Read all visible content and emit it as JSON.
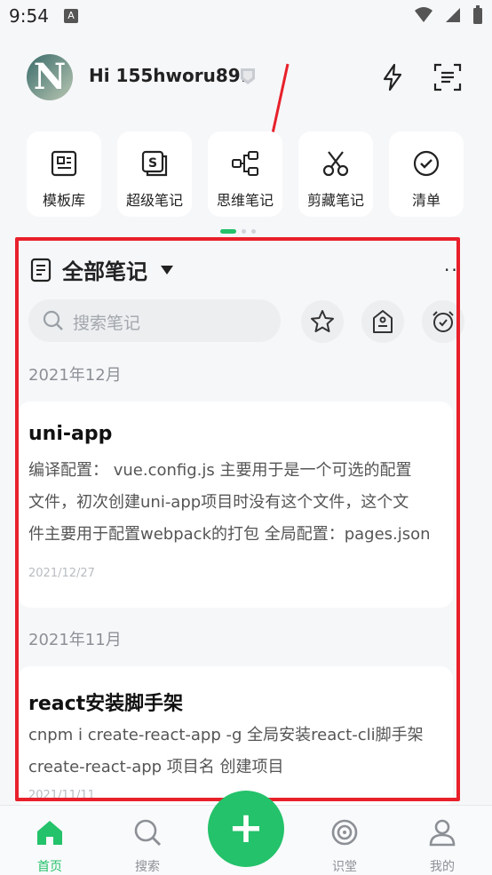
{
  "status_bar": {
    "time": "9:54",
    "notif_letter": "A"
  },
  "header": {
    "avatar_letter": "N",
    "greeting": "Hi 155hworu891"
  },
  "quick_actions": [
    {
      "label": "模板库",
      "icon": "template-library-icon"
    },
    {
      "label": "超级笔记",
      "icon": "super-note-icon"
    },
    {
      "label": "思维笔记",
      "icon": "mind-map-icon"
    },
    {
      "label": "剪藏笔记",
      "icon": "scissors-icon"
    },
    {
      "label": "清单",
      "icon": "checklist-icon"
    }
  ],
  "notes_section": {
    "title": "全部笔记",
    "more": "··",
    "search_placeholder": "搜索笔记",
    "groups": [
      {
        "month": "2021年12月",
        "notes": [
          {
            "title": "uni-app",
            "lines": [
              "编译配置： vue.config.js 主要用于是一个可选的配置",
              "文件，初次创建uni-app项目时没有这个文件，这个文",
              "件主要用于配置webpack的打包 全局配置：pages.json"
            ],
            "date": "2021/12/27"
          }
        ]
      },
      {
        "month": "2021年11月",
        "notes": [
          {
            "title": "react安装脚手架",
            "lines": [
              "cnpm i create-react-app -g 全局安装react-cli脚手架",
              "create-react-app 项目名 创建项目"
            ],
            "date": "2021/11/11"
          }
        ]
      }
    ]
  },
  "bottom_nav": {
    "items": [
      {
        "label": "首页",
        "icon": "home-icon",
        "active": true
      },
      {
        "label": "搜索",
        "icon": "search-icon",
        "active": false
      },
      {
        "label": "识堂",
        "icon": "target-icon",
        "active": false
      },
      {
        "label": "我的",
        "icon": "user-icon",
        "active": false
      }
    ],
    "fab_label": "+"
  },
  "colors": {
    "accent": "#24c26a",
    "highlight_frame": "#e8202a",
    "annotation_arrow": "#e8202a"
  }
}
